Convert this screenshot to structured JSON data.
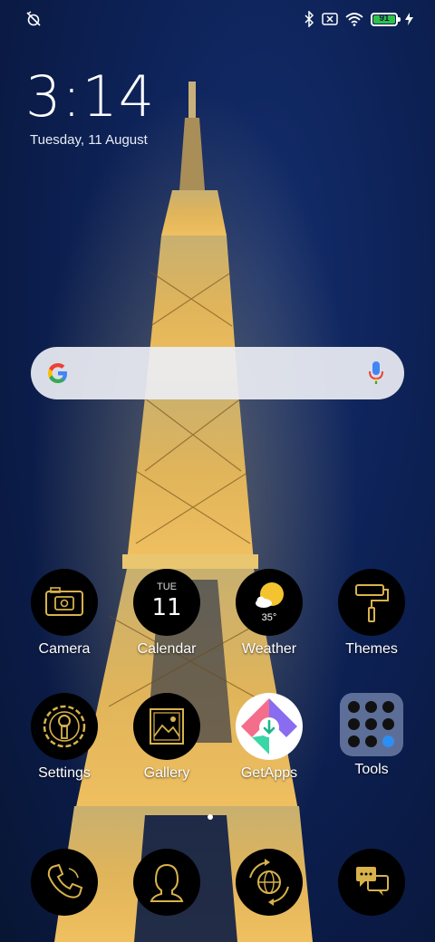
{
  "status_bar": {
    "left_icon": "alarm-off-icon",
    "right_icons": [
      "bluetooth-icon",
      "no-sim-icon",
      "wifi-icon"
    ],
    "battery_level": "91",
    "charging_icon": "bolt-icon"
  },
  "lock_clock": {
    "time": "3:14",
    "date": "Tuesday, 11 August"
  },
  "search_bar": {
    "logo": "google-g-icon",
    "mic": "mic-icon"
  },
  "apps_row1": [
    {
      "label": "Camera",
      "icon": "camera-icon"
    },
    {
      "label": "Calendar",
      "icon": "calendar-icon",
      "day": "TUE",
      "date": "11"
    },
    {
      "label": "Weather",
      "icon": "weather-icon",
      "temp": "35°"
    },
    {
      "label": "Themes",
      "icon": "paint-roller-icon"
    }
  ],
  "apps_row2": [
    {
      "label": "Settings",
      "icon": "gear-icon"
    },
    {
      "label": "Gallery",
      "icon": "gallery-icon"
    },
    {
      "label": "GetApps",
      "icon": "getapps-icon"
    },
    {
      "label": "Tools",
      "icon": "folder-icon"
    }
  ],
  "dock": [
    {
      "icon": "phone-icon"
    },
    {
      "icon": "contacts-icon"
    },
    {
      "icon": "browser-icon"
    },
    {
      "icon": "messages-icon"
    }
  ],
  "colors": {
    "accent_gold": "#d8b24a",
    "battery_green": "#2ec14a"
  }
}
